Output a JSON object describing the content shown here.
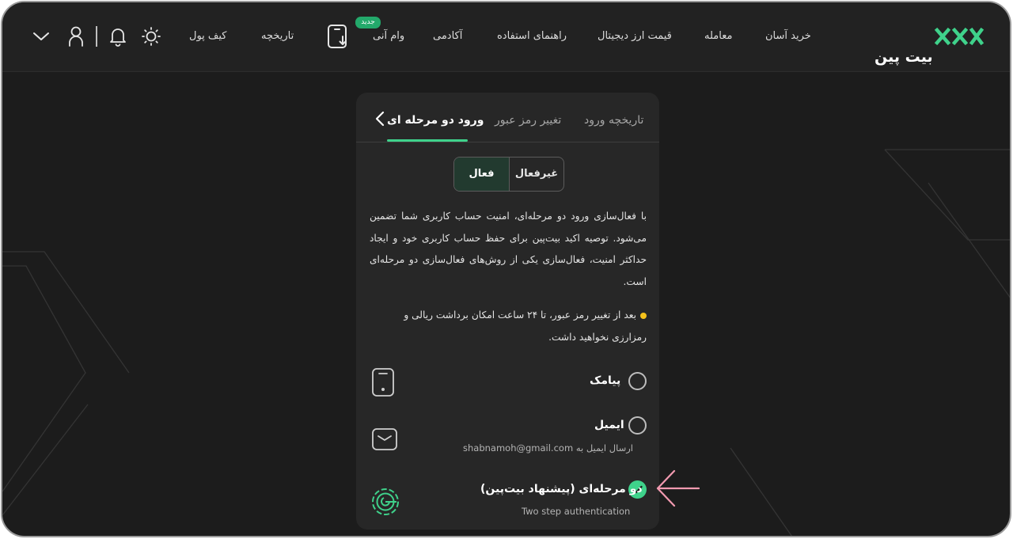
{
  "colors": {
    "accent": "#3fd28b",
    "background": "#1c1c1c",
    "card": "#272727",
    "warning_dot": "#f4c21b",
    "pointer_arrow": "#f29ab0"
  },
  "header": {
    "logo": "بیت پین",
    "nav": {
      "easy_buy": "خرید آسان",
      "trade": "معامله",
      "crypto_price": "قیمت ارز دیجیتال",
      "guide": "راهنمای استفاده",
      "academy": "آکادمی",
      "instant_loan": "وام آنی",
      "new_badge": "جدید",
      "history": "تاریخچه",
      "wallet": "کیف پول"
    },
    "icons": [
      "phone-download-icon",
      "sun-icon",
      "bell-icon",
      "user-icon",
      "chevron-down-icon"
    ]
  },
  "card": {
    "tabs": {
      "two_step": "ورود دو مرحله ای",
      "change_password": "تغییر رمز عبور",
      "login_history": "تاریخچه ورود"
    },
    "toggle": {
      "active": "فعال",
      "inactive": "غیرفعال",
      "selected": "active"
    },
    "description": "با فعال‌سازی ورود دو مرحله‌ای، امنیت حساب کاربری شما تضمین می‌شود. توصیه اکید بیت‌پین برای حفظ حساب کاربری خود و ایجاد حداکثر امنیت، فعال‌سازی یکی از روش‌های فعال‌سازی دو مرحله‌ای است.",
    "note": "بعد از تغییر رمز عبور، تا ۲۴ ساعت امکان برداشت ریالی و رمزارزی نخواهید داشت.",
    "options": {
      "sms": {
        "title": "پیامک",
        "checked": false,
        "icon": "mobile-icon"
      },
      "email": {
        "title": "ایمیل",
        "sub_prefix": "ارسال ایمیل به",
        "email": "shabnamoh@gmail.com",
        "checked": false,
        "icon": "mail-icon"
      },
      "authenticator": {
        "title": "دو مرحله‌ای (پیشنهاد بیت‌پین)",
        "sub": "Two step authentication",
        "checked": true,
        "icon": "authenticator-icon"
      }
    }
  }
}
